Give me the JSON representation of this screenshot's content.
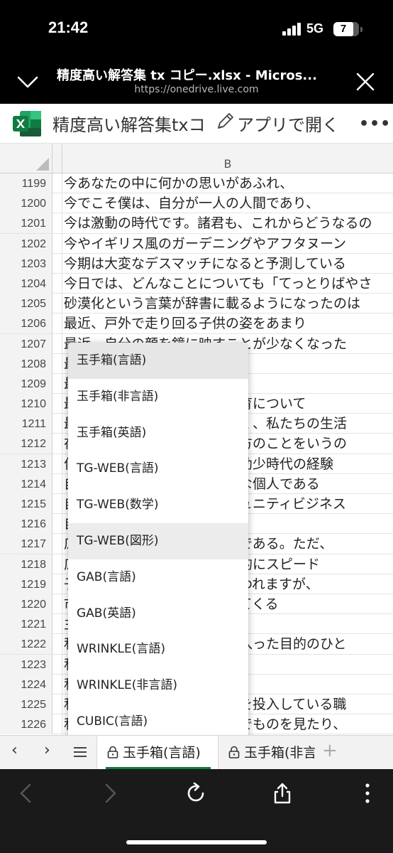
{
  "status": {
    "time": "21:42",
    "network": "5G",
    "battery": "7"
  },
  "browser": {
    "title": "精度高い解答集 tx コピー.xlsx - Micros...",
    "url": "https://onedrive.live.com"
  },
  "excel": {
    "filename": "精度高い解答集txコ",
    "open_app_label": "アプリで開く",
    "more_label": "•••",
    "column_b": "B",
    "rows": [
      {
        "num": "1199",
        "text": "今あなたの中に何かの思いがあふれ、"
      },
      {
        "num": "1200",
        "text": "今でこそ僕は、自分が一人の人間であり、"
      },
      {
        "num": "1201",
        "text": "今は激動の時代です。諸君も、これからどうなるの"
      },
      {
        "num": "1202",
        "text": "今やイギリス風のガーデニングやアフタヌーン"
      },
      {
        "num": "1203",
        "text": "今期は大変なデスマッチになると予測している"
      },
      {
        "num": "1204",
        "text": "今日では、どんなことについても「てっとりばやさ"
      },
      {
        "num": "1205",
        "text": "砂漠化という言葉が辞書に載るようになったのは"
      },
      {
        "num": "1206",
        "text": "最近、戸外で走り回る子供の姿をあまり"
      },
      {
        "num": "1207",
        "text": "最近、自分の顔を鏡に映すことが少なくなった"
      },
      {
        "num": "1208",
        "text": "最近、による事件が"
      },
      {
        "num": "1209",
        "text": "最"
      },
      {
        "num": "1210",
        "text": "最　　　　　　　　　　の飼育について"
      },
      {
        "num": "1211",
        "text": "最　　　　　　　　　覚ましく、私たちの生活"
      },
      {
        "num": "1212",
        "text": "在　　　　　　　　　な働き方のことをいうの"
      },
      {
        "num": "1213",
        "text": "作　　　　　　　　　素材は幼少時代の経験"
      },
      {
        "num": "1214",
        "text": "自　　　　　　　　　に自由な個人である"
      },
      {
        "num": "1215",
        "text": "自　　　　　　　　　　コミュニティビジネス"
      },
      {
        "num": "1216",
        "text": "自"
      },
      {
        "num": "1217",
        "text": "広　　　　　　　　　ビス業である。ただ、"
      },
      {
        "num": "1218",
        "text": "広　　　　　　　　　加速度的にスピード"
      },
      {
        "num": "1219",
        "text": "子　　　　　　　　　よく言われますが、"
      },
      {
        "num": "1220",
        "text": "市　　　　　　　　　参入してくる"
      },
      {
        "num": "1221",
        "text": "主　　　　　　　　　ラ"
      },
      {
        "num": "1222",
        "text": "私　　　　　　　　　学科に入った目的のひと"
      },
      {
        "num": "1223",
        "text": "私"
      },
      {
        "num": "1224",
        "text": "私"
      },
      {
        "num": "1225",
        "text": "私　　　　　　　　　全人格を投入している職"
      },
      {
        "num": "1226",
        "text": "私　　　　　　　　　単に目でものを見たり、"
      }
    ]
  },
  "dropdown": {
    "items": [
      {
        "label": "玉手箱(言語)",
        "state": "selected"
      },
      {
        "label": "玉手箱(非言語)",
        "state": ""
      },
      {
        "label": "玉手箱(英語)",
        "state": ""
      },
      {
        "label": "TG-WEB(言語)",
        "state": ""
      },
      {
        "label": "TG-WEB(数学)",
        "state": ""
      },
      {
        "label": "TG-WEB(図形)",
        "state": "hover"
      },
      {
        "label": "GAB(言語)",
        "state": ""
      },
      {
        "label": "GAB(英語)",
        "state": ""
      },
      {
        "label": "WRINKLE(言語)",
        "state": ""
      },
      {
        "label": "WRINKLE(非言語)",
        "state": ""
      },
      {
        "label": "CUBIC(言語)",
        "state": ""
      }
    ]
  },
  "sheet_tabs": {
    "prev": "‹",
    "next": "›",
    "active_tab": "玉手箱(言語)",
    "second_tab": "玉手箱(非言",
    "add": "+"
  },
  "colors": {
    "excel_green": "#107c41",
    "selected_bg": "#e6e6e6"
  }
}
